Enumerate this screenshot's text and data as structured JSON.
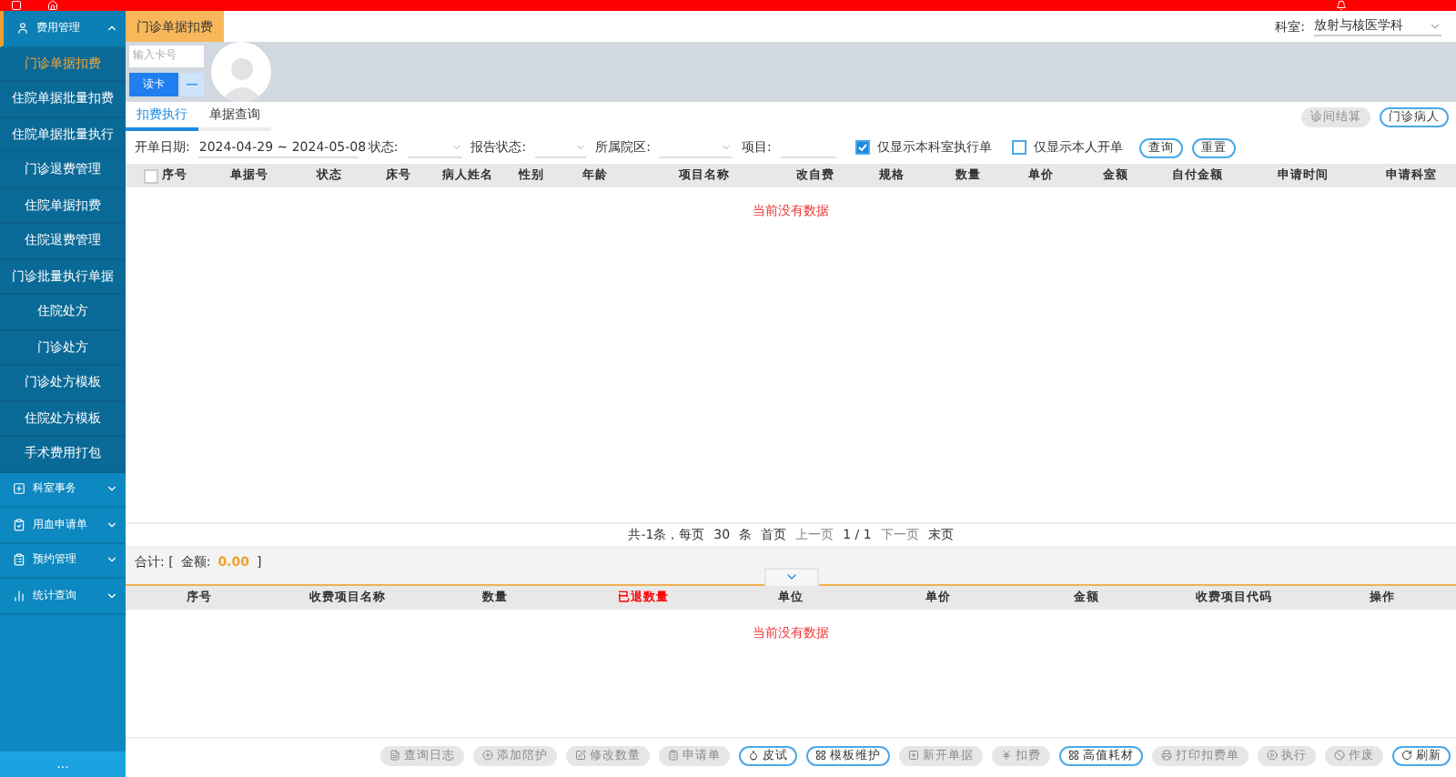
{
  "sidebar": {
    "groups": [
      {
        "label": "费用管理",
        "expanded": true,
        "children": [
          {
            "label": "门诊单据扣费",
            "selected": true
          },
          {
            "label": "住院单据批量扣费",
            "selected": false
          },
          {
            "label": "住院单据批量执行",
            "selected": false
          },
          {
            "label": "门诊退费管理",
            "selected": false
          },
          {
            "label": "住院单据扣费",
            "selected": false
          },
          {
            "label": "住院退费管理",
            "selected": false
          },
          {
            "label": "门诊批量执行单据",
            "selected": false
          },
          {
            "label": "住院处方",
            "selected": false
          },
          {
            "label": "门诊处方",
            "selected": false
          },
          {
            "label": "门诊处方模板",
            "selected": false
          },
          {
            "label": "住院处方模板",
            "selected": false
          },
          {
            "label": "手术费用打包",
            "selected": false
          }
        ]
      },
      {
        "label": "科室事务",
        "expanded": false
      },
      {
        "label": "用血申请单",
        "expanded": false
      },
      {
        "label": "预约管理",
        "expanded": false
      },
      {
        "label": "统计查询",
        "expanded": false
      }
    ],
    "more": "..."
  },
  "page_tabs": [
    {
      "label": "门诊单据扣费",
      "selected": true
    }
  ],
  "department": {
    "label": "科室:",
    "value": "放射与核医学科"
  },
  "patient": {
    "card_placeholder": "输入卡号",
    "read_button": "读卡",
    "minus_button": "—"
  },
  "side_buttons": [
    {
      "label": "诊间结算",
      "disabled": true
    },
    {
      "label": "门诊病人",
      "disabled": false
    }
  ],
  "sub_tabs": [
    {
      "label": "扣费执行",
      "selected": true
    },
    {
      "label": "单据查询",
      "selected": false
    }
  ],
  "filters": {
    "date_label": "开单日期:",
    "date_value": "2024-04-29 ~ 2024-05-08",
    "status_label": "状态:",
    "report_label": "报告状态:",
    "campus_label": "所属院区:",
    "item_label": "项目:",
    "checks": [
      {
        "label": "仅显示本科室执行单",
        "checked": true
      },
      {
        "label": "仅显示本人开单",
        "checked": false
      }
    ],
    "buttons": [
      "查询",
      "重置"
    ]
  },
  "table": {
    "columns": [
      "序号",
      "单据号",
      "状态",
      "床号",
      "病人姓名",
      "性别",
      "年龄",
      "项目名称",
      "改自费",
      "规格",
      "数量",
      "单价",
      "金额",
      "自付金额",
      "申请时间",
      "申请科室"
    ],
    "all_checked": false,
    "empty": "当前没有数据"
  },
  "pagination": {
    "total": "共-1条，每页",
    "size": "30",
    "unit": "条",
    "first": "首页",
    "prev": "上一页",
    "indicator": "1 / 1",
    "next": "下一页",
    "last": "末页",
    "prev_disabled": true,
    "next_disabled": true
  },
  "summary": {
    "prefix": "合计:  [",
    "amount_label": "金额:",
    "amount": "0.00",
    "suffix": "]"
  },
  "detail_table": {
    "columns": [
      {
        "label": "序号",
        "color": "#333333"
      },
      {
        "label": "收费项目名称",
        "color": "#333333"
      },
      {
        "label": "数量",
        "color": "#333333"
      },
      {
        "label": "已退数量",
        "color": "#ff0000"
      },
      {
        "label": "单位",
        "color": "#333333"
      },
      {
        "label": "单价",
        "color": "#333333"
      },
      {
        "label": "金额",
        "color": "#333333"
      },
      {
        "label": "收费项目代码",
        "color": "#333333"
      },
      {
        "label": "操作",
        "color": "#333333"
      }
    ],
    "empty": "当前没有数据"
  },
  "actions": [
    {
      "label": "查询日志",
      "disabled": true
    },
    {
      "label": "添加陪护",
      "disabled": true
    },
    {
      "label": "修改数量",
      "disabled": true
    },
    {
      "label": "申请单",
      "disabled": true
    },
    {
      "label": "皮试",
      "disabled": false
    },
    {
      "label": "模板维护",
      "disabled": false
    },
    {
      "label": "新开单据",
      "disabled": true
    },
    {
      "label": "扣费",
      "disabled": true
    },
    {
      "label": "高值耗材",
      "disabled": false
    },
    {
      "label": "打印扣费单",
      "disabled": true
    },
    {
      "label": "执行",
      "disabled": true
    },
    {
      "label": "作废",
      "disabled": true
    },
    {
      "label": "刷新",
      "disabled": false
    }
  ]
}
